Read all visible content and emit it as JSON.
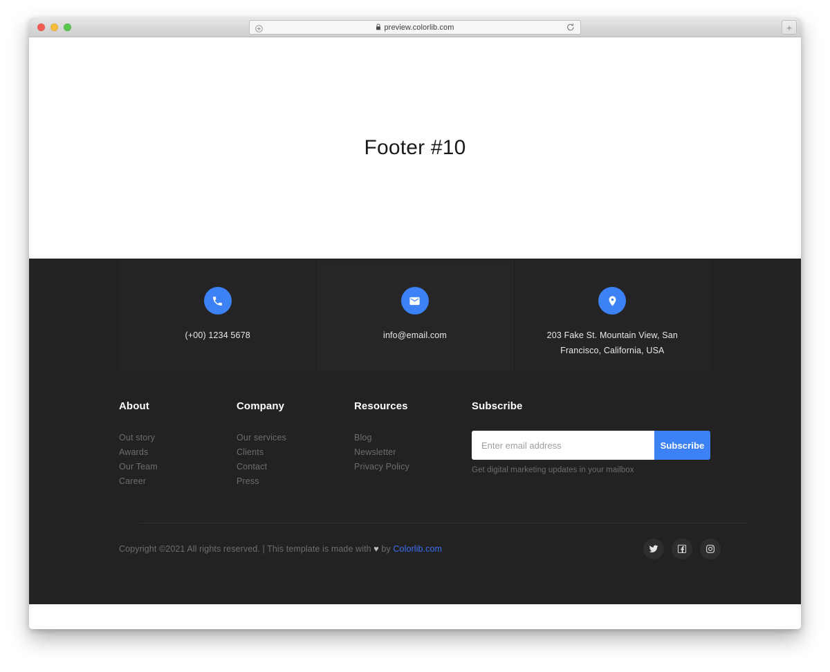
{
  "browser": {
    "traffic_lights": [
      "close",
      "minimize",
      "zoom"
    ],
    "address": {
      "url": "preview.colorlib.com",
      "lock_icon": "lock-icon",
      "left_icon": "circle-plus-icon",
      "reload_icon": "reload-icon"
    },
    "new_tab_label": "+"
  },
  "hero": {
    "title": "Footer #10"
  },
  "footer": {
    "contacts": [
      {
        "icon": "phone-icon",
        "text": "(+00) 1234 5678"
      },
      {
        "icon": "envelope-icon",
        "text": "info@email.com"
      },
      {
        "icon": "map-pin-icon",
        "text": "203 Fake St. Mountain View, San Francisco, California, USA"
      }
    ],
    "columns": [
      {
        "heading": "About",
        "links": [
          "Out story",
          "Awards",
          "Our Team",
          "Career"
        ]
      },
      {
        "heading": "Company",
        "links": [
          "Our services",
          "Clients",
          "Contact",
          "Press"
        ]
      },
      {
        "heading": "Resources",
        "links": [
          "Blog",
          "Newsletter",
          "Privacy Policy"
        ]
      }
    ],
    "subscribe": {
      "heading": "Subscribe",
      "placeholder": "Enter email address",
      "value": "",
      "button_label": "Subscribe",
      "note": "Get digital marketing updates in your mailbox"
    },
    "bottom": {
      "copyright_prefix": "Copyright ©2021 All rights reserved. | This template is made with ",
      "heart": "♥",
      "copyright_mid": " by ",
      "brand_link": "Colorlib.com",
      "social": [
        "twitter-icon",
        "facebook-icon",
        "instagram-icon"
      ]
    }
  },
  "colors": {
    "accent_blue": "#3c82f6",
    "footer_bg": "#222222",
    "contact_card_bg": "#242424",
    "link_text": "#6d6d6d",
    "brand_link": "#3c6ef6"
  }
}
